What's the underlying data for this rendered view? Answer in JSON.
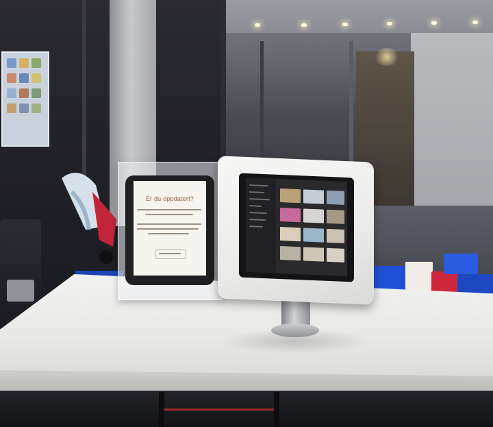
{
  "scene": {
    "sign": {
      "heading": "Er du oppdatert?"
    }
  }
}
